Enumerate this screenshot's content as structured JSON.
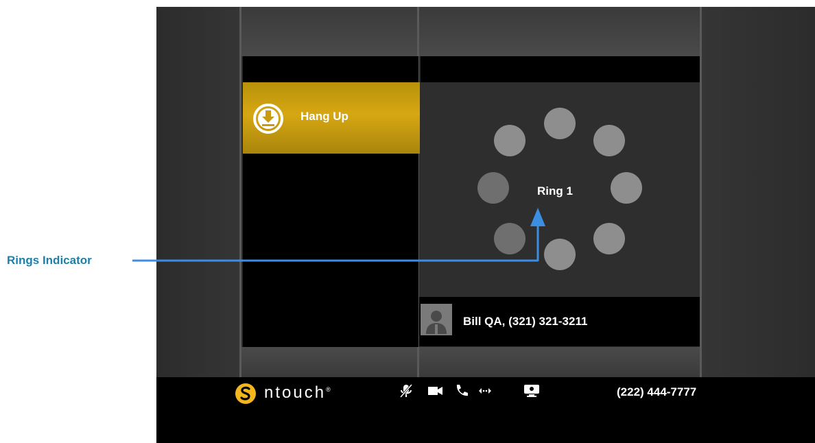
{
  "window": {
    "hang_up_label": "Hang Up",
    "ring_status": "Ring 1",
    "contact": "Bill QA, (321) 321-3211"
  },
  "taskbar": {
    "brand": "ntouch",
    "brand_mark": "®",
    "phone_number": "(222) 444-7777",
    "icons": [
      "mic-muted-icon",
      "video-camera-icon",
      "phone-icon",
      "transfer-icon",
      "monitor-icon"
    ]
  },
  "rings": {
    "total": 8,
    "dim_positions": [
      "left",
      "bottom-left"
    ]
  },
  "annotation": {
    "label": "Rings Indicator",
    "color": "#1e7fa8",
    "arrow_color": "#3b8ee0"
  },
  "colors": {
    "hangup_gold": "#d6a713",
    "ring_dot": "#8e8e8e",
    "ring_dot_dim": "#6f6f6f"
  }
}
